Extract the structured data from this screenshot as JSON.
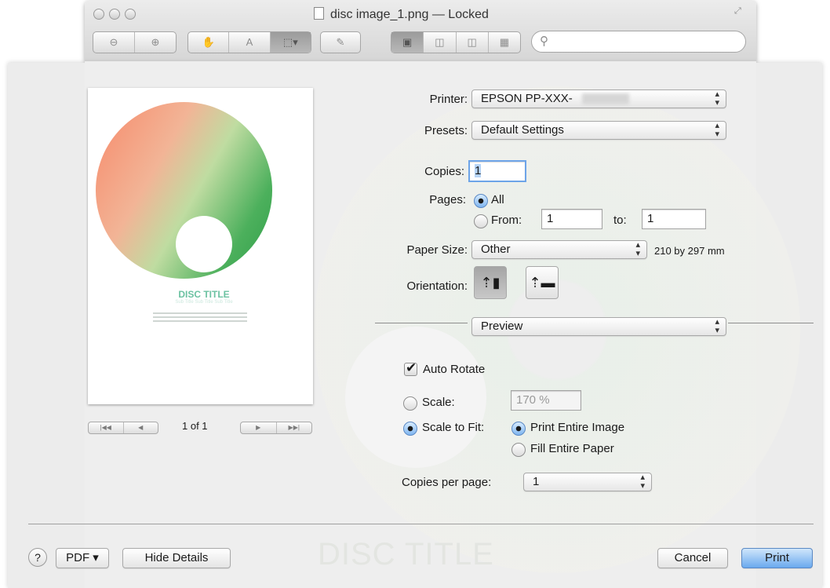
{
  "window": {
    "title": "disc image_1.png — Locked",
    "toolbar": {
      "zoom_out_icon": "zoom-out-icon",
      "zoom_in_icon": "zoom-in-icon",
      "search_placeholder": ""
    }
  },
  "preview": {
    "disc_title": "DISC TITLE",
    "disc_subtitle": "Sub Title Sub Title Sub Title",
    "page_indicator": "1 of 1"
  },
  "print": {
    "printer_label": "Printer:",
    "printer_value": "EPSON PP-XXX-",
    "presets_label": "Presets:",
    "presets_value": "Default Settings",
    "copies_label": "Copies:",
    "copies_value": "1",
    "pages_label": "Pages:",
    "pages_all": "All",
    "pages_from": "From:",
    "pages_from_value": "1",
    "pages_to": "to:",
    "pages_to_value": "1",
    "paper_size_label": "Paper Size:",
    "paper_size_value": "Other",
    "paper_size_dims": "210 by 297 mm",
    "orientation_label": "Orientation:",
    "section_value": "Preview",
    "auto_rotate": "Auto Rotate",
    "scale_label": "Scale:",
    "scale_value": "170 %",
    "scale_to_fit": "Scale to Fit:",
    "print_entire_image": "Print Entire Image",
    "fill_entire_paper": "Fill Entire Paper",
    "copies_per_page_label": "Copies per page:",
    "copies_per_page_value": "1"
  },
  "footer": {
    "help": "?",
    "pdf": "PDF ▾",
    "hide_details": "Hide Details",
    "cancel": "Cancel",
    "print": "Print"
  },
  "background": {
    "ghost_title": "DISC TITLE"
  },
  "colors": {
    "primary_button": "#6aa9ee",
    "sheet_bg": "#eeeeee"
  }
}
